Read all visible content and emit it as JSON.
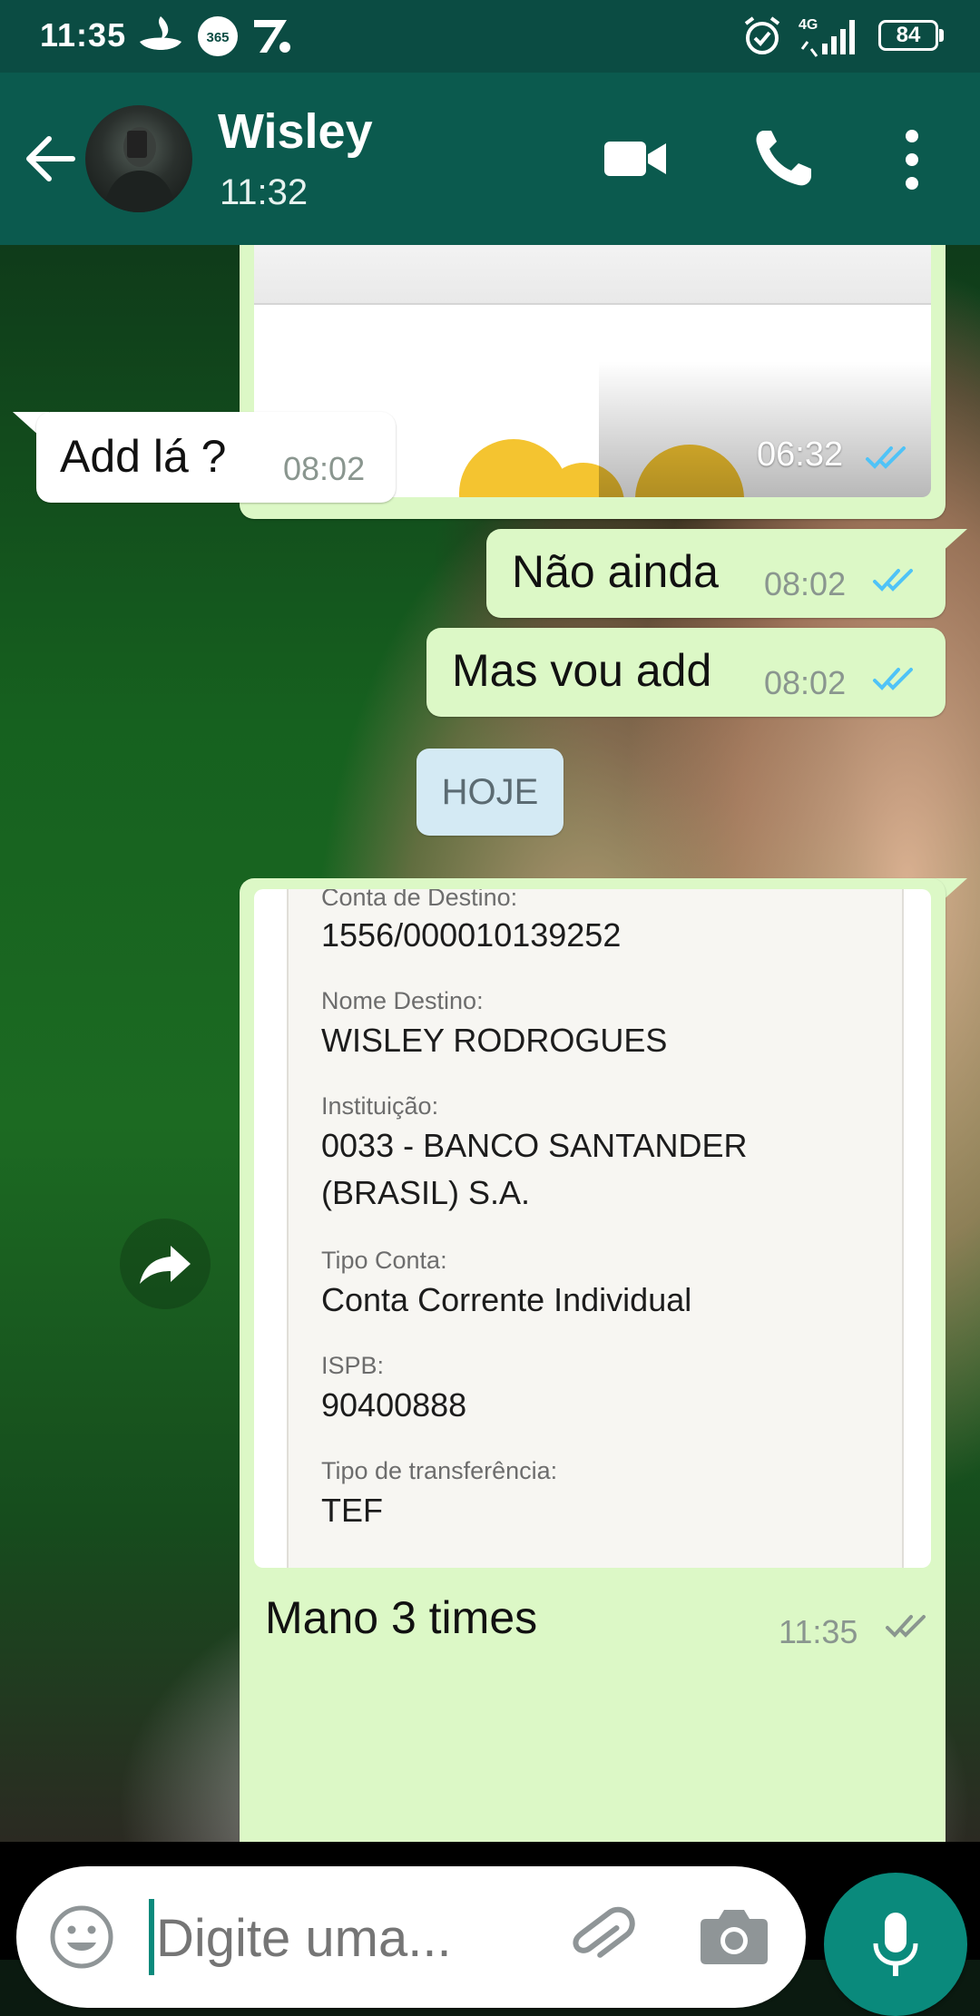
{
  "status_bar": {
    "time": "11:35",
    "network": "4G",
    "battery": "84"
  },
  "header": {
    "contact_name": "Wisley",
    "contact_status": "11:32"
  },
  "messages": [
    {
      "direction": "outgoing",
      "type": "image",
      "time": "06:32",
      "read": true
    },
    {
      "direction": "incoming",
      "text": "Add lá ?",
      "time": "08:02"
    },
    {
      "direction": "outgoing",
      "text": "Não ainda",
      "time": "08:02",
      "read": true
    },
    {
      "direction": "outgoing",
      "text": "Mas vou add",
      "time": "08:02",
      "read": true
    },
    {
      "type": "date_divider",
      "text": "HOJE"
    },
    {
      "direction": "outgoing",
      "type": "image",
      "caption": "Mano 3 times",
      "time": "11:35",
      "read": false,
      "image_text": {
        "conta_label": "Conta de Destino:",
        "conta_value": "1556/000010139252",
        "nome_label": "Nome Destino:",
        "nome_value": "WISLEY RODROGUES",
        "inst_label": "Instituição:",
        "inst_value_1": "0033 - BANCO SANTANDER",
        "inst_value_2": "(BRASIL) S.A.",
        "tipo_conta_label": "Tipo Conta:",
        "tipo_conta_value": "Conta Corrente Individual",
        "ispb_label": "ISPB:",
        "ispb_value": "90400888",
        "tipo_transf_label": "Tipo de transferência:",
        "tipo_transf_value": "TEF"
      }
    }
  ],
  "composer": {
    "placeholder": "Digite uma..."
  },
  "icons": {
    "back": "arrow-back-icon",
    "video": "video-call-icon",
    "phone": "phone-icon",
    "more": "more-vert-icon",
    "emoji": "emoji-icon",
    "attach": "paperclip-icon",
    "camera": "camera-icon",
    "mic": "mic-icon",
    "forward": "forward-icon"
  },
  "colors": {
    "header": "#0b5a4e",
    "status_bar": "#0b4c43",
    "outgoing_bubble": "#dcf8c6",
    "incoming_bubble": "#ffffff",
    "read_tick": "#4fc3f7",
    "mic_button": "#0a8a7c"
  }
}
